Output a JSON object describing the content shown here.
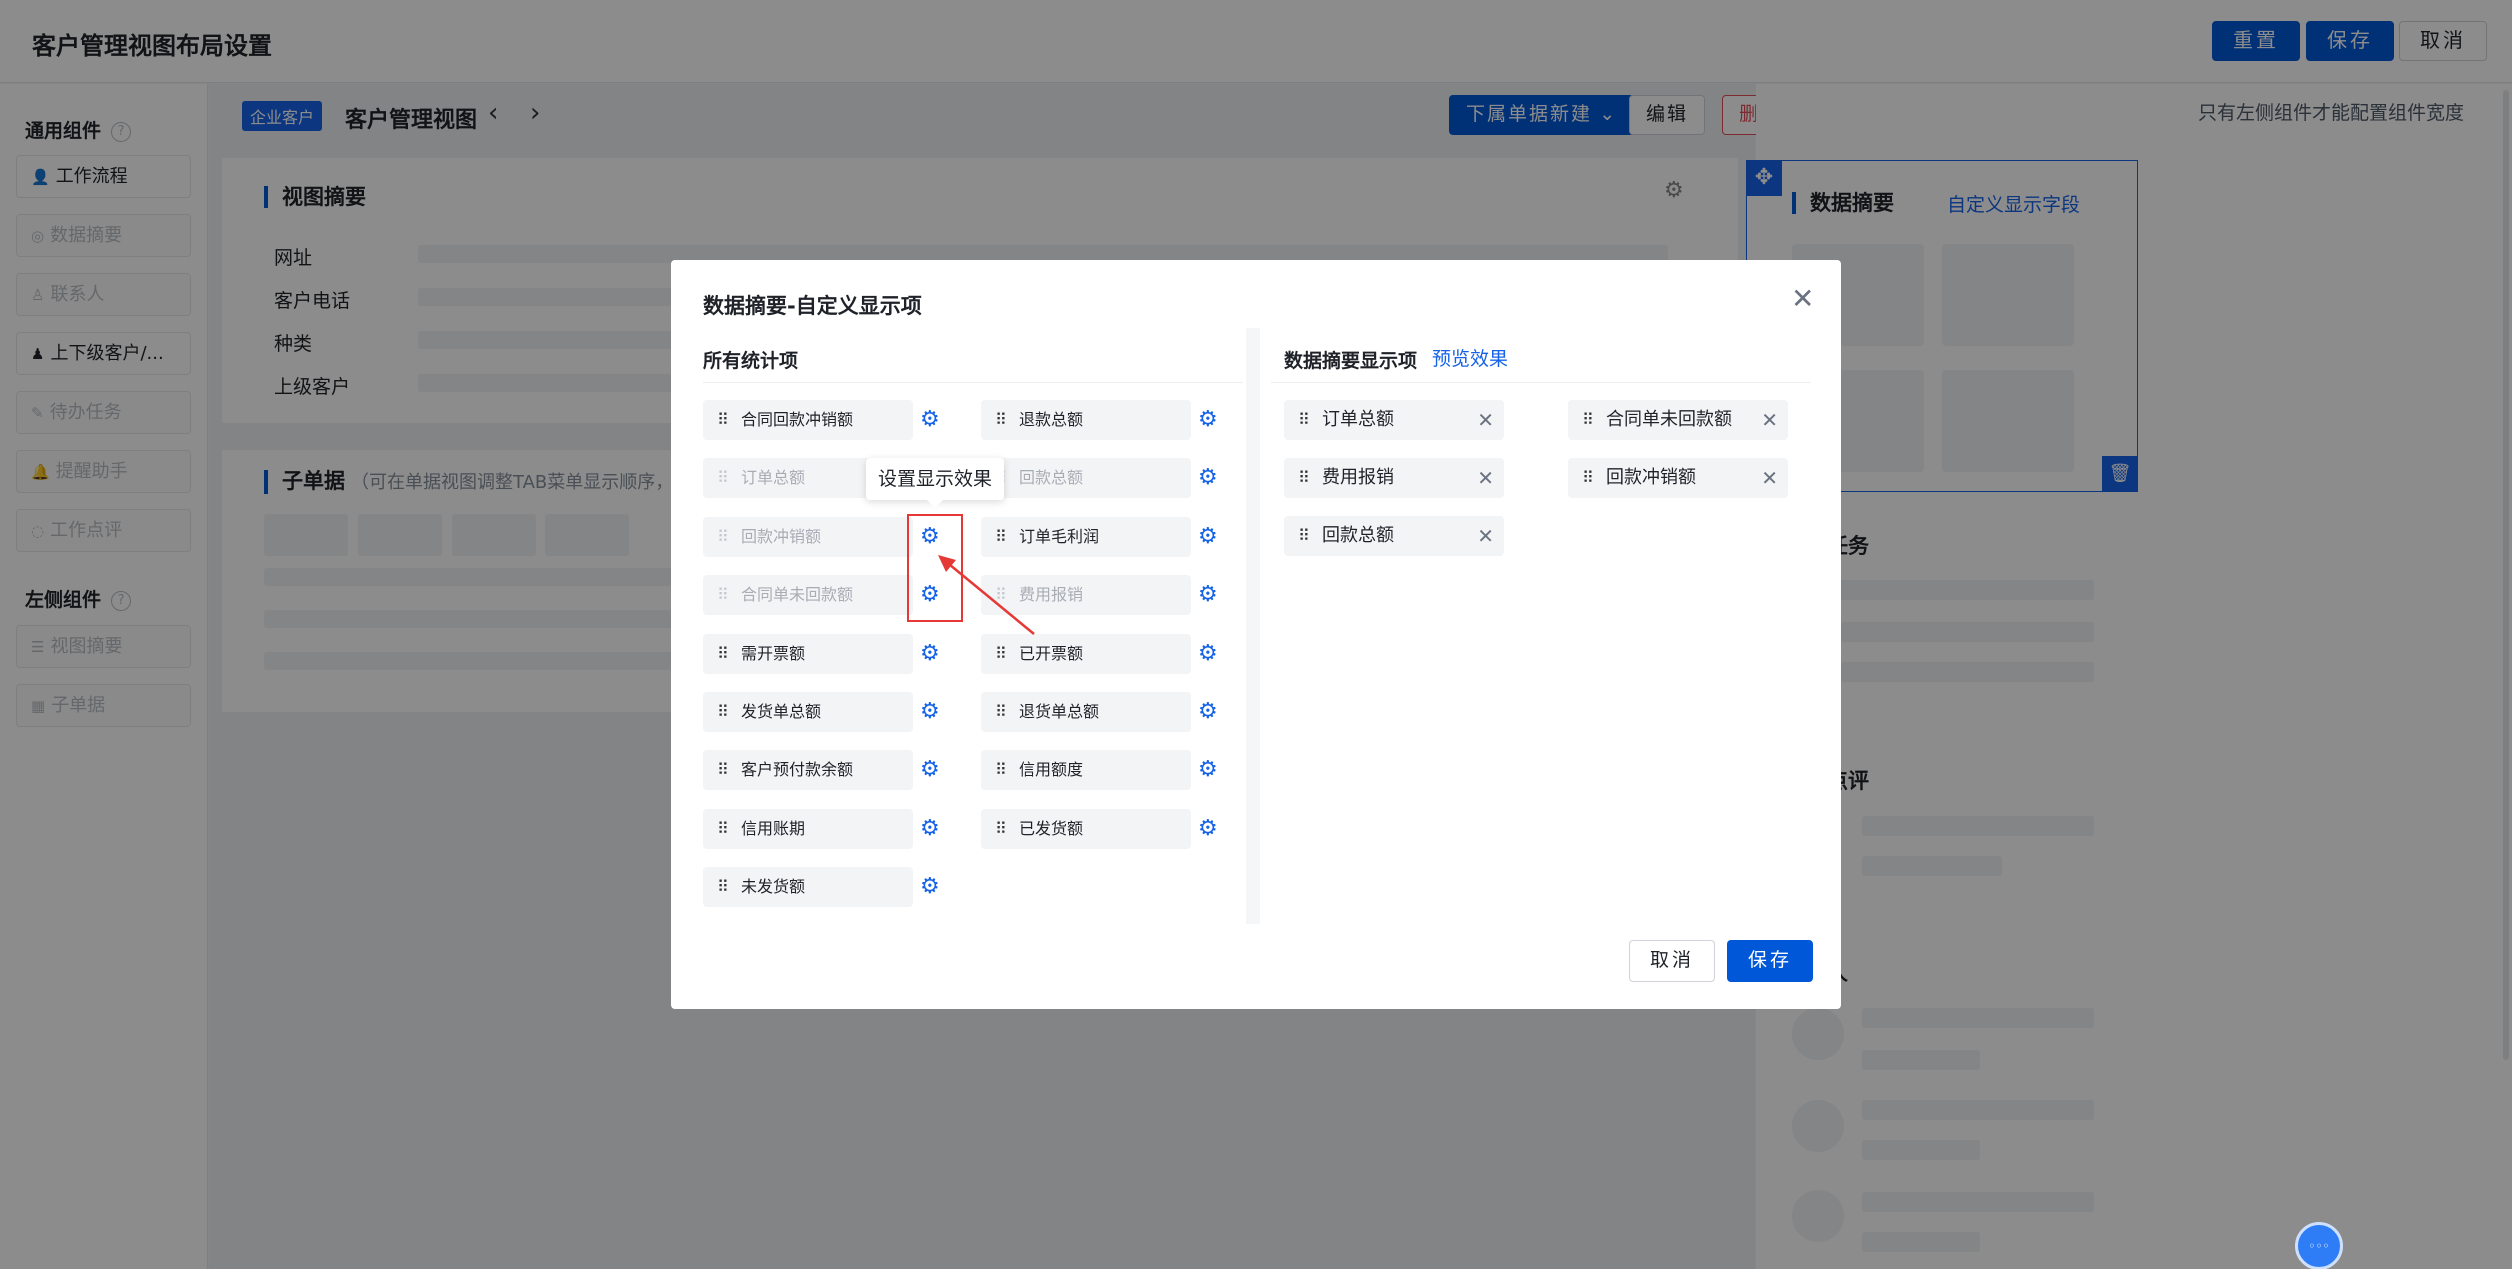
{
  "topbar": {
    "title": "客户管理视图布局设置",
    "reset": "重置",
    "save": "保存",
    "cancel": "取消"
  },
  "leftpanel": {
    "general_title": "通用组件",
    "general": [
      {
        "label": "工作流程",
        "icon": "user-icon",
        "disabled": false
      },
      {
        "label": "数据摘要",
        "icon": "circle-icon",
        "disabled": true
      },
      {
        "label": "联系人",
        "icon": "person-icon",
        "disabled": true
      },
      {
        "label": "上下级客户/...",
        "icon": "hierarchy-icon",
        "disabled": false
      },
      {
        "label": "待办任务",
        "icon": "pin-icon",
        "disabled": true
      },
      {
        "label": "提醒助手",
        "icon": "bell-icon",
        "disabled": true
      },
      {
        "label": "工作点评",
        "icon": "comment-icon",
        "disabled": true
      }
    ],
    "side_title": "左侧组件",
    "side": [
      {
        "label": "视图摘要",
        "icon": "list-icon",
        "disabled": true
      },
      {
        "label": "子单据",
        "icon": "grid-icon",
        "disabled": true
      }
    ]
  },
  "center": {
    "tag": "企业客户",
    "title": "客户管理视图",
    "new_btn": "下属单据新建",
    "edit_btn": "编辑",
    "delete_btn": "删除",
    "summary_title": "视图摘要",
    "fields": [
      "网址",
      "客户电话",
      "种类",
      "上级客户"
    ],
    "sub_title": "子单据",
    "sub_hint": "（可在单据视图调整TAB菜单显示顺序，创"
  },
  "rightpanel": {
    "hint": "只有左侧组件才能配置组件宽度",
    "data_title": "数据摘要",
    "custom_link": "自定义显示字段",
    "sections": [
      "办任务",
      "作点评",
      "系人"
    ]
  },
  "modal": {
    "title": "数据摘要-自定义显示项",
    "all_title": "所有统计项",
    "display_title": "数据摘要显示项",
    "preview_link": "预览效果",
    "items_left": [
      {
        "label": "合同回款冲销额",
        "disabled": false
      },
      {
        "label": "订单总额",
        "disabled": true
      },
      {
        "label": "回款冲销额",
        "disabled": true
      },
      {
        "label": "合同单未回款额",
        "disabled": true
      },
      {
        "label": "需开票额",
        "disabled": false
      },
      {
        "label": "发货单总额",
        "disabled": false
      },
      {
        "label": "客户预付款余额",
        "disabled": false
      },
      {
        "label": "信用账期",
        "disabled": false
      },
      {
        "label": "未发货额",
        "disabled": false
      }
    ],
    "items_right": [
      {
        "label": "退款总额",
        "disabled": false
      },
      {
        "label": "回款总额",
        "disabled": true
      },
      {
        "label": "订单毛利润",
        "disabled": false
      },
      {
        "label": "费用报销",
        "disabled": true
      },
      {
        "label": "已开票额",
        "disabled": false
      },
      {
        "label": "退货单总额",
        "disabled": false
      },
      {
        "label": "信用额度",
        "disabled": false
      },
      {
        "label": "已发货额",
        "disabled": false
      }
    ],
    "selected_left": [
      "订单总额",
      "费用报销",
      "回款总额"
    ],
    "selected_right": [
      "合同单未回款额",
      "回款冲销额"
    ],
    "tooltip": "设置显示效果",
    "cancel": "取消",
    "save": "保存"
  }
}
